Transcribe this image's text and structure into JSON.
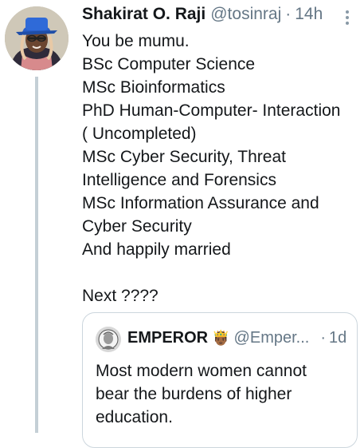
{
  "tweet": {
    "author_name": "Shakirat O. Raji",
    "handle": "@tosinraj",
    "separator": "·",
    "time": "14h",
    "avatar_icon": "profile-photo-icon",
    "more_icon": "more-vertical-icon",
    "body_lines": [
      "You be mumu.",
      "BSc Computer Science",
      "MSc Bioinformatics",
      "PhD Human-Computer- Interaction",
      "( Uncompleted)",
      "MSc Cyber Security, Threat",
      "Intelligence and Forensics",
      "MSc Information Assurance and",
      "Cyber Security",
      "And happily married",
      "",
      "Next ????"
    ]
  },
  "quoted_tweet": {
    "author_name": "EMPEROR",
    "emoji": "🤴🏾",
    "handle": "@Emper...",
    "separator": "·",
    "time": "1d",
    "avatar_icon": "profile-photo-icon",
    "text_lines": [
      "Most modern women cannot",
      "bear the burdens of higher",
      "education."
    ]
  },
  "colors": {
    "text_primary": "#14171a",
    "text_secondary": "#657786",
    "border": "#ccd6dd",
    "thread_line": "#c4cfd6"
  }
}
